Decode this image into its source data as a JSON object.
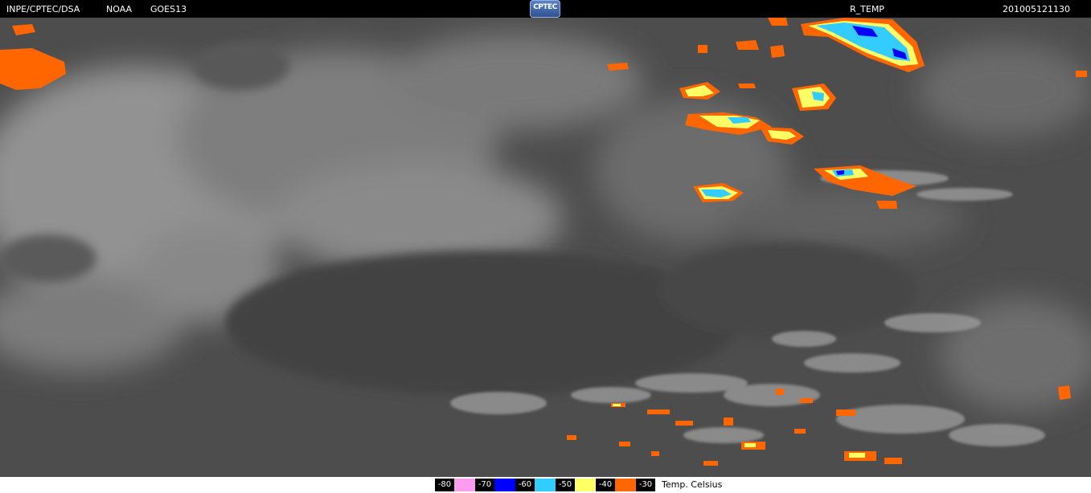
{
  "header": {
    "source": "INPE/CPTEC/DSA",
    "agency": "NOAA",
    "satellite": "GOES13",
    "logo_text": "CPTEC",
    "product": "R_TEMP",
    "timestamp": "201005121130"
  },
  "legend": {
    "items": [
      {
        "label": "-80",
        "color": "#ff9cf0"
      },
      {
        "label": "-70",
        "color": "#0000ff"
      },
      {
        "label": "-60",
        "color": "#33ccff"
      },
      {
        "label": "-50",
        "color": "#ffff66"
      },
      {
        "label": "-40",
        "color": "#ff6600"
      },
      {
        "label": "-30",
        "color": ""
      }
    ],
    "unit_label": "Temp. Celsius"
  },
  "colors": {
    "background": "#4a4a4a",
    "cloud_light": "#9a9a9a",
    "cloud_mid": "#767676"
  }
}
